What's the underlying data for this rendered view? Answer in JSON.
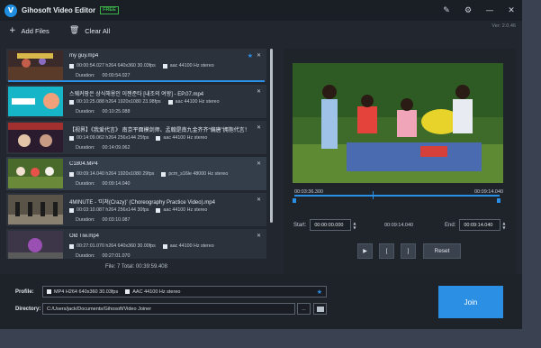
{
  "app": {
    "title": "Gihosoft Video Editor",
    "badge": "FREE",
    "version": "Ver: 2.0.46",
    "logo_letter": "V"
  },
  "titlebar_icons": [
    "edit-icon",
    "gear-icon",
    "minimize-icon",
    "close-icon"
  ],
  "toolbar": {
    "add_label": "Add Files",
    "clear_label": "Clear All"
  },
  "files": [
    {
      "name": "my guy.mp4",
      "info": "00:00:54.027 h264 640x360 30.03fps",
      "audio": "aac 44100 Hz stereo",
      "duration_label": "Duration:",
      "duration": "00:00:54.027",
      "starred": true
    },
    {
      "name": "스웨커팡은 상식해용인 이젠준타 [내조의 여왕] - EP.07.mp4",
      "info": "00:10:25.088 h264 1920x1080 23.98fps",
      "audio": "aac 44100 Hz stereo",
      "duration_label": "Duration:",
      "duration": "00:10:25.088"
    },
    {
      "name": "【视界】《我爱代言》 南京平面模剑师、孟翰是南九金齐齐“偏唐”拥抱代言！《《",
      "info": "00:14:09.062 h264 256x144 25fps",
      "audio": "aac 44100 Hz stereo",
      "duration_label": "Duration:",
      "duration": "00:14:09.062"
    },
    {
      "name": "C1804.MP4",
      "info": "00:09:14.040 h264 1920x1080 29fps",
      "audio": "pcm_s16le 48000 Hz stereo",
      "duration_label": "Duration:",
      "duration": "00:09:14.040"
    },
    {
      "name": "4MINUTE - '미쳐(Crazy)' (Choreography Practice Video).mp4",
      "info": "00:03:10.087 h264 256x144 30fps",
      "audio": "aac 44100 Hz stereo",
      "duration_label": "Duration:",
      "duration": "00:03:10.087"
    },
    {
      "name": "Old Tiw.mp4",
      "info": "00:27:01.070 h264 640x360 30.00fps",
      "audio": "aac 44100 Hz stereo",
      "duration_label": "Duration:",
      "duration": "00:27:01.070"
    }
  ],
  "totals": "File: 7   Total: 00:39:59.408",
  "preview": {
    "start_time": "00:03:36.300",
    "end_time": "00:09:14.040",
    "start_label": "Start:",
    "start_value": "00:00:00.000",
    "middle_time": "00:09:14.040",
    "end_label": "End:",
    "end_value": "00:09:14.040",
    "play_icon": "▶",
    "bracket_open": "[",
    "bracket_close": "]",
    "reset_label": "Reset"
  },
  "output": {
    "profile_label": "Profile:",
    "profile_video": "MP4 H264 640x360 30.03fps",
    "profile_audio": "AAC 44100 Hz stereo",
    "directory_label": "Directory:",
    "directory": "C:/Users/jack/Documents/Gihosoft/Video Joiner",
    "browse_label": "...",
    "join_label": "Join"
  },
  "colors": {
    "accent": "#2a8fe6",
    "free": "#3bb54a",
    "bg": "#22272f"
  }
}
